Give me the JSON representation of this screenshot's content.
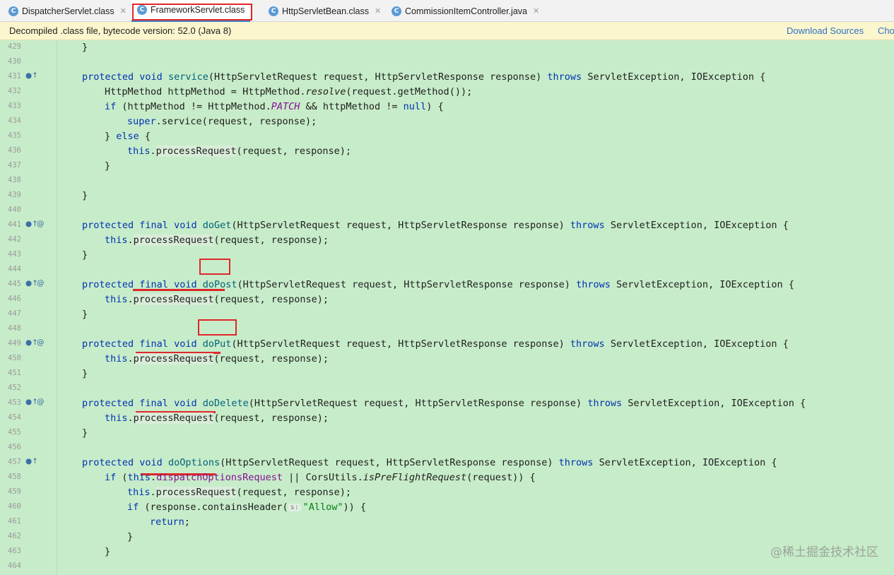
{
  "tabs": [
    {
      "label": "DispatcherServlet.class",
      "icon": "C"
    },
    {
      "label": "FrameworkServlet.class",
      "icon": "C",
      "active": true
    },
    {
      "label": "HttpServletBean.class",
      "icon": "C"
    },
    {
      "label": "CommissionItemController.java",
      "icon": "C"
    }
  ],
  "infobar": {
    "message": "Decompiled .class file, bytecode version: 52.0 (Java 8)",
    "download_sources": "Download Sources",
    "choose_sources": "Cho"
  },
  "code": {
    "line_numbers": [
      "429",
      "430",
      "431",
      "432",
      "433",
      "434",
      "435",
      "436",
      "437",
      "438",
      "439",
      "440",
      "441",
      "442",
      "443",
      "444",
      "445",
      "446",
      "447",
      "448",
      "449",
      "450",
      "451",
      "452",
      "453",
      "454",
      "455",
      "456",
      "457",
      "458",
      "459",
      "460",
      "461",
      "462",
      "463",
      "464"
    ],
    "tokens": {
      "protected": "protected",
      "final": "final",
      "void": "void",
      "throws": "throws",
      "this": "this",
      "super": "super",
      "if": "if",
      "else": "else",
      "null": "null",
      "return": "return",
      "service": "service",
      "doGet": "doGet",
      "doPost": "doPost",
      "doPut": "doPut",
      "doDelete": "doDelete",
      "doOptions": "doOptions",
      "processRequest": "processRequest",
      "resolve": "resolve",
      "PATCH": "PATCH",
      "dispatchOptionsRequest": "dispatchOptionsRequest",
      "isPreFlightRequest": "isPreFlightRequest",
      "allow": "\"Allow\"",
      "hint_s": "s:"
    },
    "text": {
      "close_brace": "}",
      "params_sig": "(HttpServletRequest request, HttpServletResponse response) ",
      "exceptions": " ServletException, IOException {",
      "http_method_decl": "HttpMethod httpMethod = HttpMethod.",
      "resolve_args": "(request.getMethod());",
      "if_open": " (httpMethod != HttpMethod.",
      "if_mid": " && httpMethod != ",
      "if_close": ") {",
      "service_call": ".service(request, response);",
      "else_open": "} ",
      "else_close": " {",
      "dot": ".",
      "process_args": "(request, response);",
      "or_cors": " || CorsUtils.",
      "cors_args": "(request)) {",
      "contains_header": " (response.containsHeader(",
      "contains_close": ")) {",
      "if_paren": " (",
      "semicolon": ";",
      "space": " "
    }
  },
  "gutter_icons": {
    "override": "●↑",
    "annotation": "@"
  },
  "watermark": "@稀土掘金技术社区",
  "colors": {
    "background": "#c7ecc9",
    "keyword": "#0033b3",
    "method": "#00627a",
    "highlight": "#e0262b"
  }
}
